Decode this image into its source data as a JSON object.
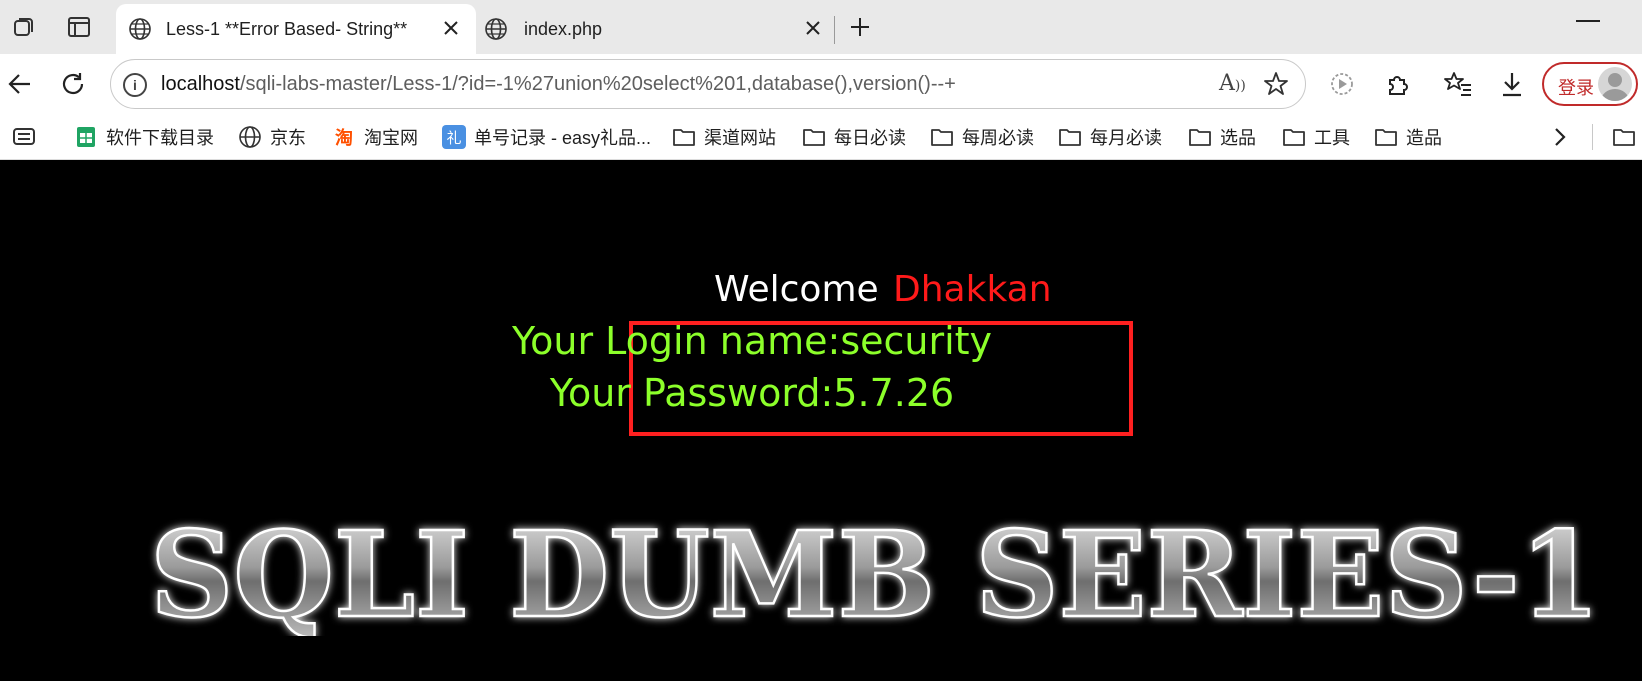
{
  "tabs": [
    {
      "title": "Less-1 **Error Based- String**",
      "active": true
    },
    {
      "title": "index.php",
      "active": false
    }
  ],
  "address_bar": {
    "host": "localhost",
    "path": "/sqli-labs-master/Less-1/?id=-1%27union%20select%201,database(),version()--+"
  },
  "profile": {
    "login_label": "登录"
  },
  "bookmarks": [
    {
      "label": "软件下载目录",
      "icon": "sheet-icon"
    },
    {
      "label": "京东",
      "icon": "globe-icon"
    },
    {
      "label": "淘宝网",
      "icon": "taobao-icon"
    },
    {
      "label": "单号记录 - easy礼品...",
      "icon": "gift-icon"
    },
    {
      "label": "渠道网站",
      "icon": "folder-icon"
    },
    {
      "label": "每日必读",
      "icon": "folder-icon"
    },
    {
      "label": "每周必读",
      "icon": "folder-icon"
    },
    {
      "label": "每月必读",
      "icon": "folder-icon"
    },
    {
      "label": "选品",
      "icon": "folder-icon"
    },
    {
      "label": "工具",
      "icon": "folder-icon"
    },
    {
      "label": "造品",
      "icon": "folder-icon"
    }
  ],
  "page": {
    "welcome": "Welcome",
    "user": "Dhakkan",
    "login_name_line": "Your Login name:security",
    "password_line": "Your Password:5.7.26",
    "banner_text": "SQLI DUMB SERIES-1"
  },
  "colors": {
    "welcome": "#ffffff",
    "user": "#ff1a1a",
    "result_text": "#8cff2a",
    "highlight_box": "#ff2020",
    "login_button": "#c02a2a"
  }
}
